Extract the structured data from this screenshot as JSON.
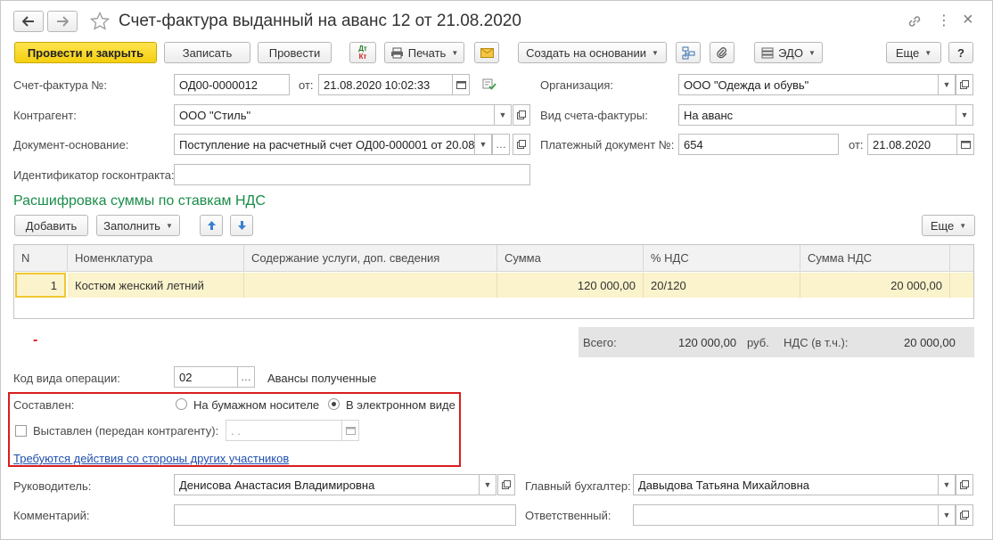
{
  "window": {
    "title": "Счет-фактура выданный на аванс 12 от 21.08.2020",
    "back_icon": "arrow-left-icon",
    "forward_icon": "arrow-right-icon",
    "star_icon": "star-icon",
    "link_icon": "link-icon",
    "more_icon": "kebab-icon",
    "close_icon": "close-icon",
    "close_glyph": "×",
    "more_glyph": "⋮"
  },
  "toolbar": {
    "post_close": "Провести и закрыть",
    "save": "Записать",
    "post": "Провести",
    "dtkt_top": "Дт",
    "dtkt_bottom": "Кт",
    "print": "Печать",
    "create_based": "Создать на основании",
    "edo": "ЭДО",
    "more": "Еще",
    "help": "?"
  },
  "form": {
    "invoice_no_label": "Счет-фактура №:",
    "invoice_no": "ОД00-0000012",
    "from_label": "от:",
    "invoice_date": "21.08.2020 10:02:33",
    "org_label": "Организация:",
    "org": "ООО \"Одежда и обувь\"",
    "counterparty_label": "Контрагент:",
    "counterparty": "ООО \"Стиль\"",
    "invoice_kind_label": "Вид счета-фактуры:",
    "invoice_kind": "На аванс",
    "base_doc_label": "Документ-основание:",
    "base_doc": "Поступление на расчетный счет ОД00-000001 от 20.08.",
    "payment_doc_label": "Платежный документ №:",
    "payment_doc": "654",
    "payment_from_label": "от:",
    "payment_date": "21.08.2020",
    "gov_contract_label": "Идентификатор госконтракта:",
    "gov_contract": ""
  },
  "vat_section": {
    "title": "Расшифровка суммы по ставкам НДС",
    "add": "Добавить",
    "fill": "Заполнить",
    "more": "Еще",
    "columns": [
      "N",
      "Номенклатура",
      "Содержание услуги, доп. сведения",
      "Сумма",
      "% НДС",
      "Сумма НДС"
    ],
    "rows": [
      {
        "n": "1",
        "item": "Костюм женский летний",
        "content": "",
        "sum": "120 000,00",
        "vat_rate": "20/120",
        "vat_sum": "20 000,00"
      }
    ],
    "dash": "-"
  },
  "totals": {
    "total_label": "Всего:",
    "total": "120 000,00",
    "currency": "руб.",
    "vat_label": "НДС (в т.ч.):",
    "vat": "20 000,00"
  },
  "operation": {
    "label": "Код вида операции:",
    "code": "02",
    "description": "Авансы полученные"
  },
  "compiled": {
    "label": "Составлен:",
    "paper": "На бумажном носителе",
    "electronic": "В электронном виде",
    "selected": "electronic",
    "issued_label": "Выставлен (передан контрагенту):",
    "issued_date": " .  .",
    "actions_link": "Требуются действия со стороны других участников"
  },
  "signatures": {
    "head_label": "Руководитель:",
    "head": "Денисова Анастасия Владимировна",
    "accountant_label": "Главный бухгалтер:",
    "accountant": "Давыдова Татьяна Михайловна",
    "comment_label": "Комментарий:",
    "comment": "",
    "responsible_label": "Ответственный:",
    "responsible": ""
  },
  "colors": {
    "primary_button": "#f5cf10",
    "section_title": "#1a8c4a",
    "highlight_row": "#fbf3cc",
    "red_frame": "#d81e1e",
    "link": "#1f4fb0"
  }
}
